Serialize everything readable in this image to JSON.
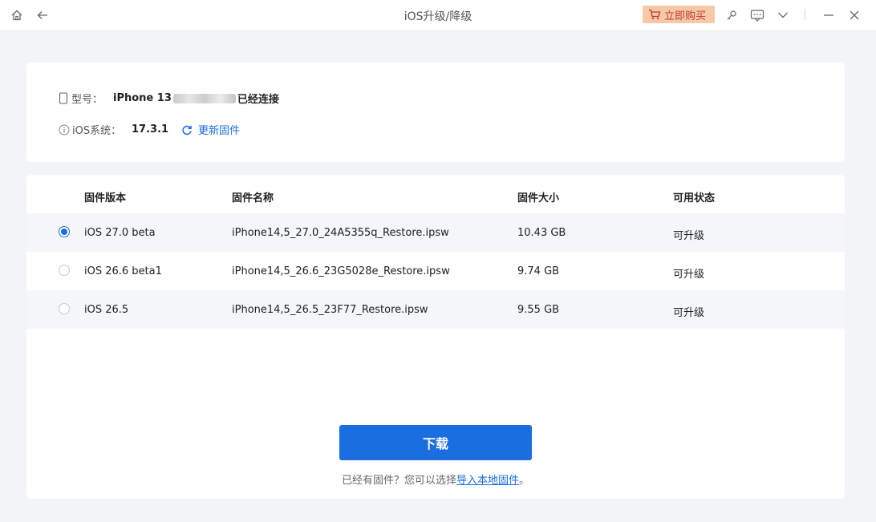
{
  "titlebar": {
    "title": "iOS升级/降级",
    "buy_label": "立即购买",
    "icons": [
      "home-icon",
      "back-arrow-icon",
      "cart-icon",
      "key-icon",
      "message-icon",
      "chevron-down-icon",
      "minimize-icon",
      "close-icon"
    ]
  },
  "device": {
    "model_label": "型号：",
    "model_value": "iPhone 13",
    "connected_text": "已经连接",
    "ios_label": "iOS系统：",
    "ios_value": "17.3.1",
    "update_firmware": "更新固件"
  },
  "table": {
    "headers": [
      "固件版本",
      "固件名称",
      "固件大小",
      "可用状态"
    ],
    "rows": [
      {
        "version": "iOS 27.0 beta",
        "name": "iPhone14,5_27.0_24A5355q_Restore.ipsw",
        "size": "10.43 GB",
        "status": "可升级",
        "selected": true
      },
      {
        "version": "iOS 26.6 beta1",
        "name": "iPhone14,5_26.6_23G5028e_Restore.ipsw",
        "size": "9.74 GB",
        "status": "可升级",
        "selected": false
      },
      {
        "version": "iOS 26.5",
        "name": "iPhone14,5_26.5_23F77_Restore.ipsw",
        "size": "9.55 GB",
        "status": "可升级",
        "selected": false
      }
    ]
  },
  "actions": {
    "download_label": "下载",
    "hint_prefix": "已经有固件？您可以选择",
    "hint_link": "导入本地固件",
    "hint_suffix": "。"
  },
  "colors": {
    "accent": "#1a6ee0",
    "buy_bg": "#f7c9a8",
    "buy_text": "#c0392b"
  }
}
